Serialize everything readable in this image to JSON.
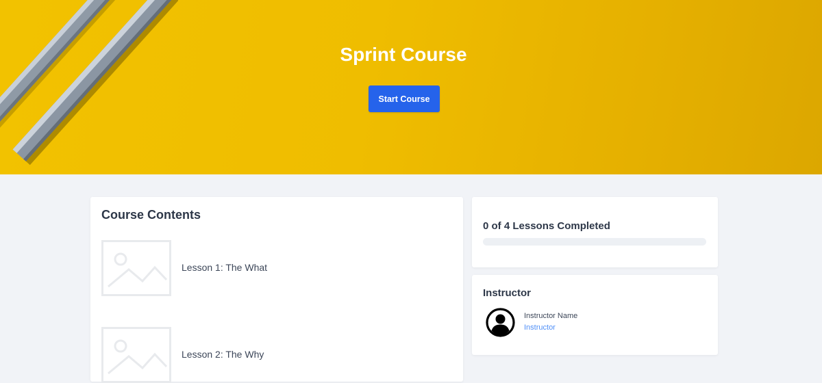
{
  "hero": {
    "title": "Sprint Course",
    "start_button": "Start Course",
    "background_color": "#efbd00"
  },
  "contents": {
    "heading": "Course Contents",
    "lessons": [
      {
        "label": "Lesson 1: The What",
        "thumbnail_icon": "image-placeholder-icon"
      },
      {
        "label": "Lesson 2: The Why",
        "thumbnail_icon": "image-placeholder-icon"
      }
    ]
  },
  "progress": {
    "text": "0 of 4 Lessons Completed",
    "completed": 0,
    "total": 4
  },
  "instructor": {
    "heading": "Instructor",
    "name": "Instructor Name",
    "role": "Instructor",
    "avatar_icon": "user-circle-icon"
  },
  "colors": {
    "accent": "#2563eb",
    "link": "#4f8ff7",
    "page_background": "#f1f3f7"
  }
}
